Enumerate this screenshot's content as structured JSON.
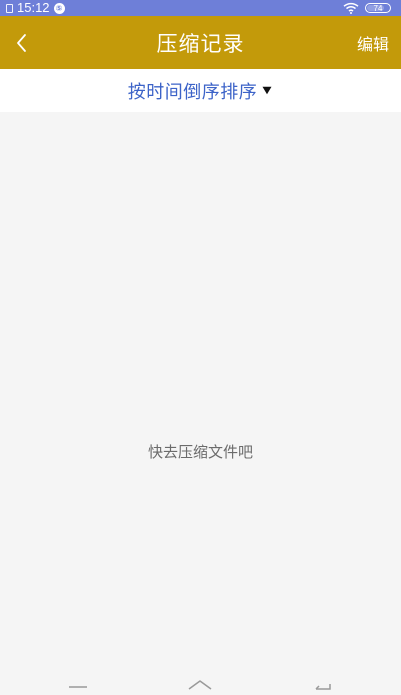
{
  "status_bar": {
    "time": "15:12",
    "notification_badge": "⑤",
    "battery_level": "74",
    "icons": [
      "sim-icon",
      "notification-icon",
      "wifi-icon",
      "battery-icon"
    ]
  },
  "header": {
    "back_icon": "chevron-left-icon",
    "title": "压缩记录",
    "edit_label": "编辑"
  },
  "sort": {
    "label": "按时间倒序排序",
    "icon": "dropdown-triangle-icon"
  },
  "empty_state": {
    "message": "快去压缩文件吧"
  },
  "navigation": {
    "icons": [
      "menu-icon",
      "home-icon",
      "back-icon"
    ]
  },
  "colors": {
    "status_bar": "#6e7fd8",
    "title_bar": "#c39a0a",
    "sort_text": "#3c63c8",
    "background": "#f5f5f5",
    "empty_text": "#6b6b6b"
  }
}
